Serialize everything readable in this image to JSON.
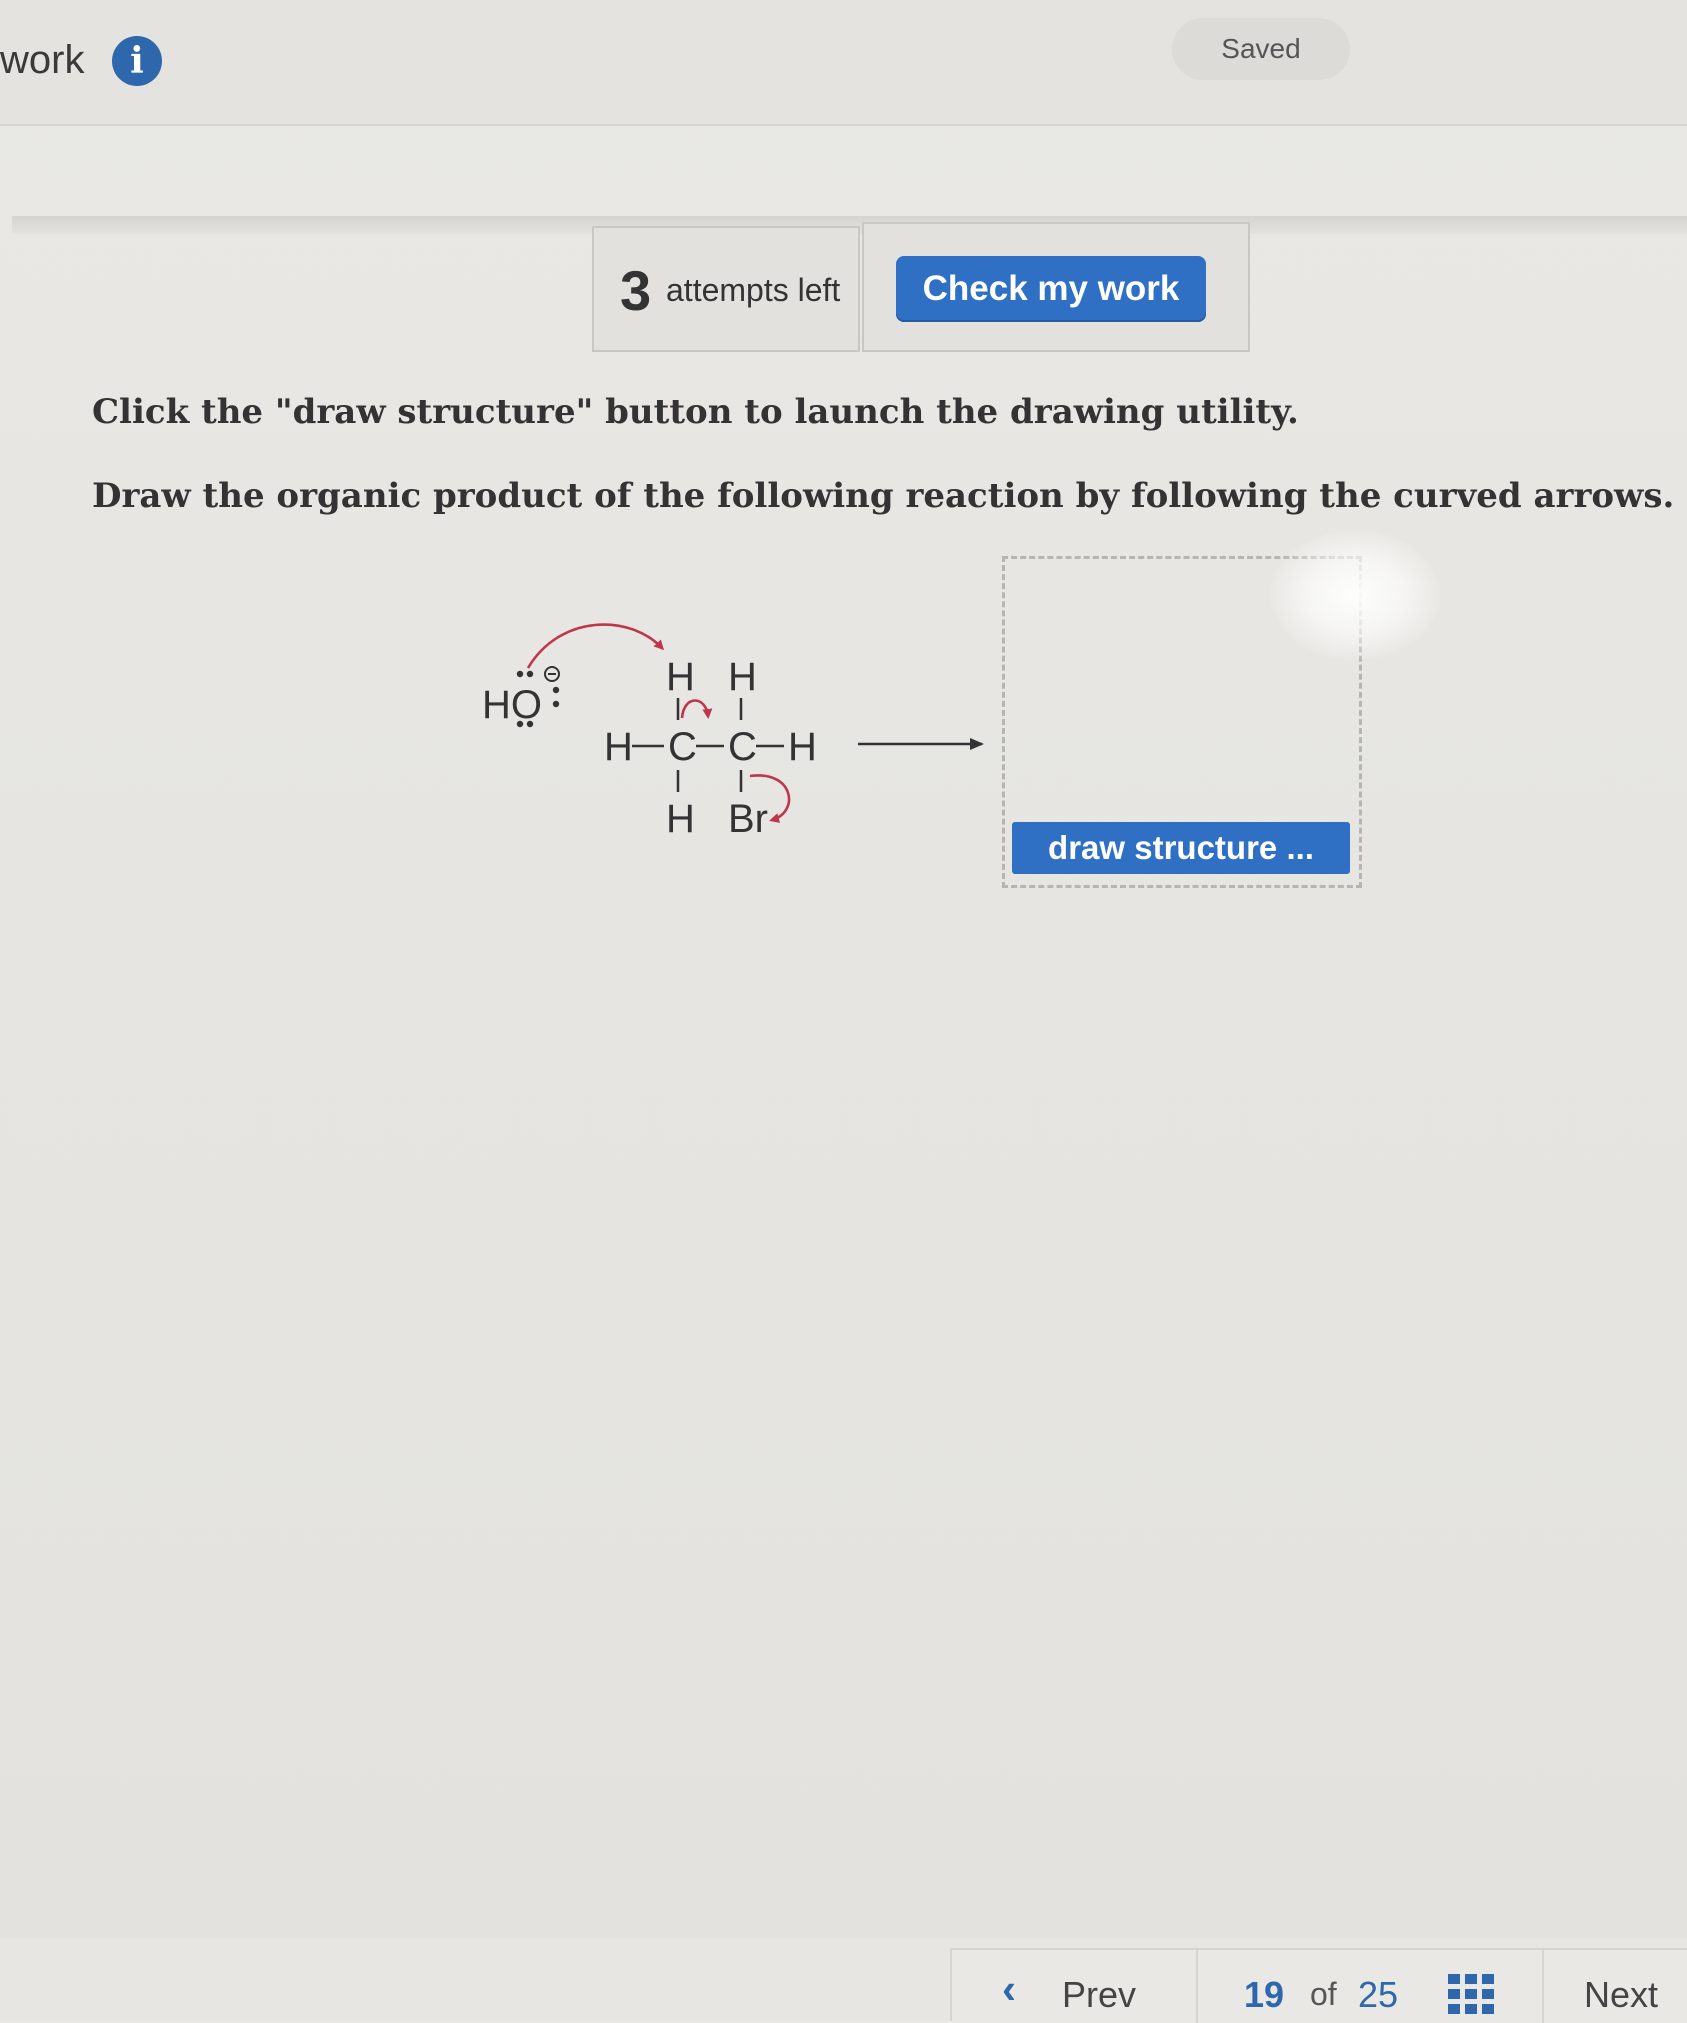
{
  "header": {
    "title": "work",
    "info_icon": "info-icon",
    "saved_label": "Saved"
  },
  "toolbar": {
    "attempts_count": "3",
    "attempts_label": "attempts left",
    "check_label": "Check my work"
  },
  "question": {
    "instruction_1": "Click the \"draw structure\" button to launch the drawing utility.",
    "instruction_2": "Draw the organic product of the following reaction by following the curved arrows.",
    "reagent": "HO",
    "atoms": {
      "h_top_left": "H",
      "h_top_right": "H",
      "h_left": "H",
      "c1": "C",
      "c2": "C",
      "h_right": "H",
      "h_bottom": "H",
      "br": "Br"
    },
    "arrow_color": "#c0354a"
  },
  "answer": {
    "draw_button_label": "draw structure ..."
  },
  "navigation": {
    "prev_label": "Prev",
    "current_page": "19",
    "of_label": "of",
    "total_pages": "25",
    "next_label": "Next",
    "accent": "#2f67ad"
  }
}
